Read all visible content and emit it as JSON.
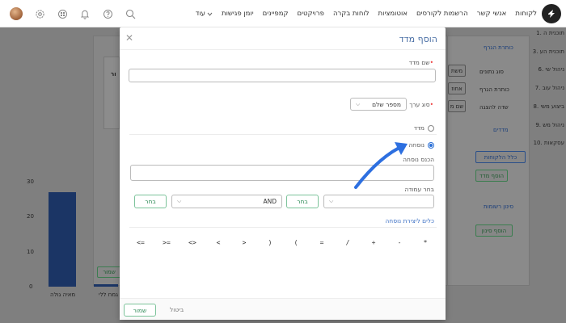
{
  "header": {
    "nav": [
      "לקוחות",
      "אנשי קשר",
      "הרשמות לקורסים",
      "אוטומציות",
      "לוחות בקרה",
      "פרויקטים",
      "קמפיינים",
      "יומן פגישות"
    ],
    "more_label": "עוד"
  },
  "background": {
    "right_labels": [
      "1. תוכנית ה",
      "3. תוכנית הע",
      "6. ניהול שי",
      "7. ניהול עוב",
      "8. ביצוע משי",
      "9. ניהול מש",
      "10. עסקאות"
    ],
    "section_target": "כותרת הגרף",
    "data_type_label": "סוג נתונים",
    "graph_title_label": "כותרת הגרף",
    "display_field_label": "שדה להצגה",
    "data_type_value": "משת",
    "graph_title_value": "אחוז",
    "display_field_value": "שם מ",
    "measures_heading": "מדדים",
    "all_customers_btn": "כלל הלקוחות",
    "add_measure_btn": "הוסף מדד",
    "filter_heading": "סינון רשומות",
    "add_filter_btn": "הוסף סינון",
    "save_btn": "שמור",
    "left_chart": {
      "y_ticks": [
        "30",
        "20",
        "10",
        "0"
      ],
      "x_labels": [
        "מאיה גולה",
        "גמח ללי"
      ],
      "side_label": "ור"
    }
  },
  "modal": {
    "title": "הוסף מדד",
    "measure_name_label": "שם מדד",
    "value_type_label": "סוג ערך",
    "value_type_selected": "מספר שלם",
    "radio_measure": "מדד",
    "radio_formula": "נוסחה",
    "enter_formula_label": "הכנס נוסחה",
    "choose_column_label": "בחר עמודה",
    "choose_button": "בחר",
    "operator_selected": "AND",
    "choose_button_2": "בחר",
    "formula_tools_link": "כלים ליצירת נוסחה",
    "operators": [
      "*",
      "-",
      "+",
      "/",
      "=",
      "(",
      ")",
      ">",
      "<",
      "<>",
      ">=",
      "<="
    ],
    "cancel_label": "ביטול",
    "save_label": "שמור"
  },
  "colors": {
    "accent": "#2a6fd6",
    "success": "#2e8b57",
    "title": "#4a6fa5",
    "bar": "#1b3565"
  }
}
